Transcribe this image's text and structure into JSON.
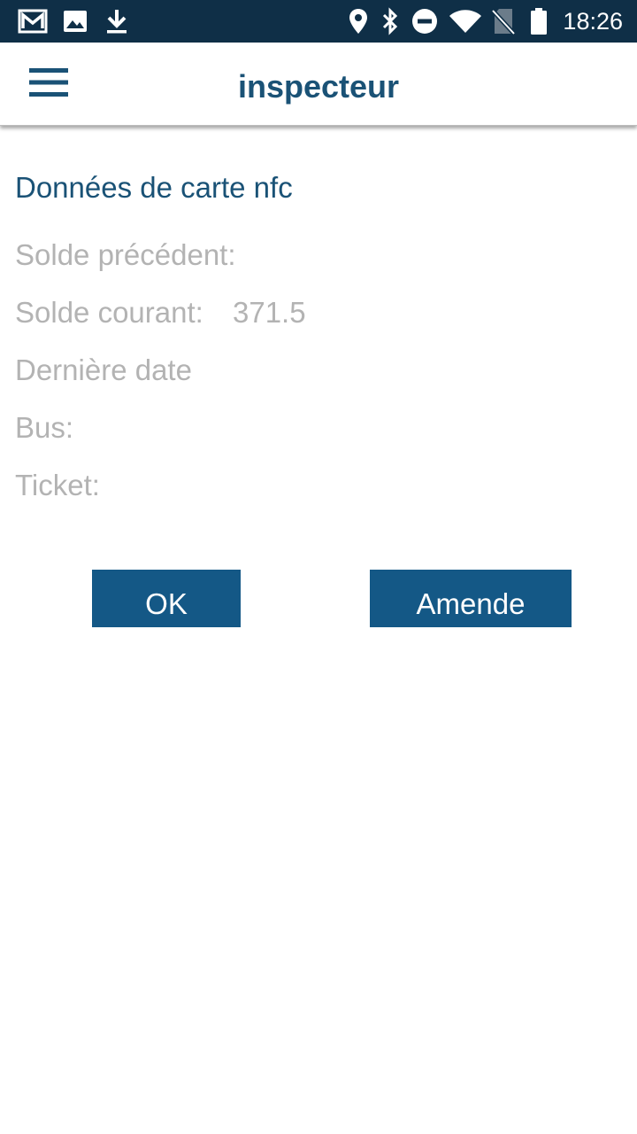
{
  "status_bar": {
    "time": "18:26",
    "left_icons": [
      "gmail-icon",
      "image-icon",
      "download-icon"
    ],
    "right_icons": [
      "location-icon",
      "bluetooth-icon",
      "do-not-disturb-icon",
      "wifi-icon",
      "no-sim-icon",
      "battery-icon"
    ]
  },
  "app_bar": {
    "title": "inspecteur",
    "menu_icon": "hamburger-menu-icon"
  },
  "card": {
    "section_title": "Données de carte nfc",
    "previous_balance_label": "Solde précédent:",
    "previous_balance_value": "",
    "current_balance_label": "Solde courant:",
    "current_balance_value": "371.5",
    "last_date_label": "Dernière date",
    "bus_label": "Bus:",
    "ticket_label": "Ticket:"
  },
  "actions": {
    "ok_label": "OK",
    "amende_label": "Amende"
  },
  "colors": {
    "status_bar_bg": "#0f2f47",
    "accent": "#1a5276",
    "button_bg": "#145886",
    "muted_text": "#b3b3b3"
  }
}
